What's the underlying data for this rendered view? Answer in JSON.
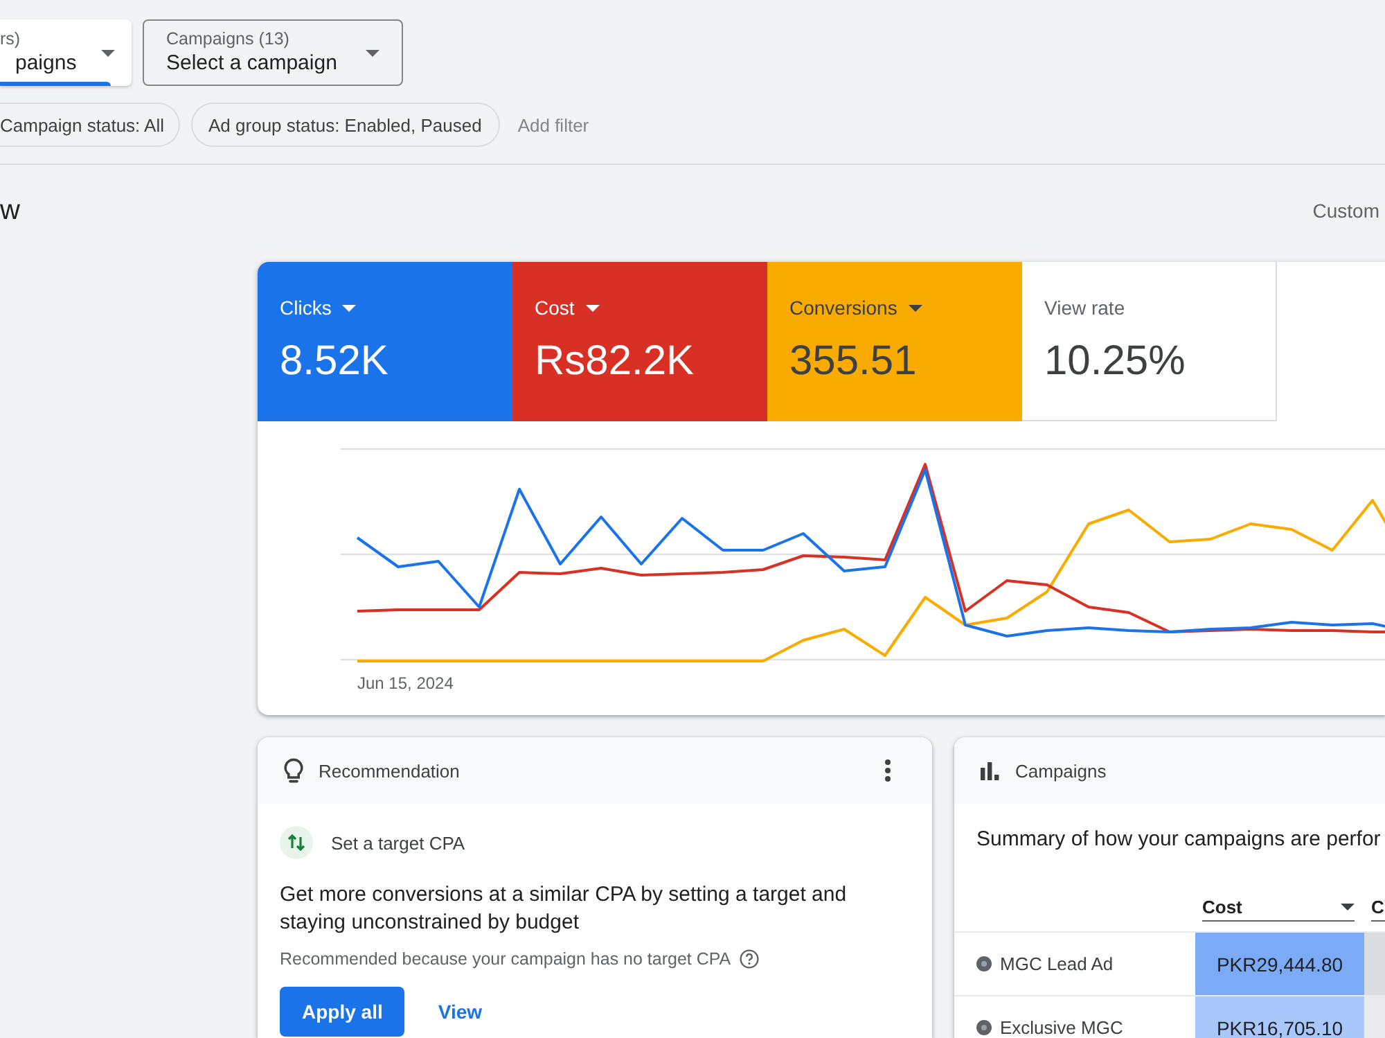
{
  "filters": {
    "dropdowns": [
      {
        "label": "rs)",
        "value": "paigns",
        "selected": true
      },
      {
        "label": "Campaigns (13)",
        "value": "Select a campaign",
        "selected": false
      }
    ],
    "chips": [
      "Campaign status: All",
      "Ad group status: Enabled, Paused"
    ],
    "add_filter": "Add filter"
  },
  "page": {
    "title": "w",
    "date_range": "Custom"
  },
  "metrics": [
    {
      "label": "Clicks",
      "value": "8.52K",
      "selected": true,
      "color": "#1a73e8"
    },
    {
      "label": "Cost",
      "value": "Rs82.2K",
      "selected": true,
      "color": "#d93025"
    },
    {
      "label": "Conversions",
      "value": "355.51",
      "selected": true,
      "color": "#f9ab00"
    },
    {
      "label": "View rate",
      "value": "10.25%",
      "selected": false
    }
  ],
  "chart": {
    "date_label": "Jun 15, 2024"
  },
  "recommendation_card": {
    "title": "Recommendation",
    "item": "Set a target CPA",
    "description": "Get more conversions at a similar CPA by setting a target and staying unconstrained by budget",
    "reason": "Recommended because your campaign has no target CPA",
    "buttons": [
      {
        "label": "Apply all",
        "kind": "primary"
      },
      {
        "label": "View",
        "kind": "text"
      }
    ]
  },
  "campaigns_card": {
    "title": "Campaigns",
    "summary": "Summary of how your campaigns are perfor",
    "columns": [
      {
        "label": "Cost",
        "dropdown": true
      },
      {
        "label": "C",
        "dropdown": false
      }
    ],
    "rows": [
      {
        "name": "MGC Lead Ad",
        "cells": [
          {
            "value": "PKR29,444.80",
            "color": "#7baaf7"
          },
          {
            "color": "#dadce0"
          }
        ]
      },
      {
        "name": "Exclusive MGC",
        "cells": [
          {
            "value": "PKR16,705.10",
            "color": "#a8c7fa"
          },
          {
            "color": "#e8eaed"
          }
        ]
      }
    ]
  }
}
